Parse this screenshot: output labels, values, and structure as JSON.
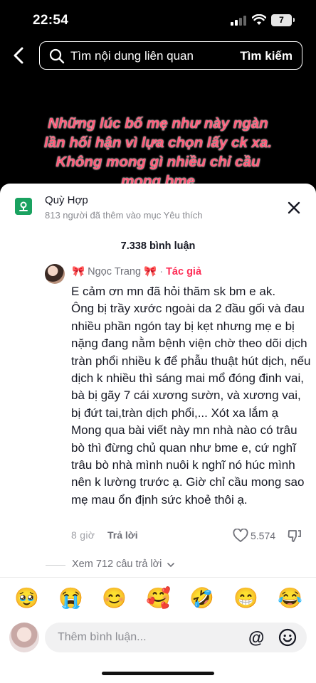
{
  "status_bar": {
    "time": "22:54",
    "battery": "7"
  },
  "search": {
    "placeholder": "Tìm nội dung liên quan",
    "action": "Tìm kiếm"
  },
  "video": {
    "caption": "Những lúc bố mẹ như này ngàn lần hối hận vì lựa chọn lấy ck xa. Không mong gì nhiều chỉ cầu mong bme"
  },
  "place": {
    "name": "Quỳ Hợp",
    "subtitle": "813 người đã thêm vào mục Yêu thích"
  },
  "comments_header": {
    "count": "7.338 bình luận"
  },
  "comment": {
    "bow_left": "🎀",
    "author": "Ngọc Trang",
    "bow_right": "🎀",
    "separator": "·",
    "badge": "Tác giả",
    "text": "E cảm ơn mn đã hỏi thăm sk bm e ak.\nÔng bị trầy xước ngoài da 2 đầu gối và đau nhiều phần ngón tay bị kẹt nhưng mẹ e bị nặng đang nằm bệnh viện chờ theo dõi dịch tràn phổi nhiều k để phẫu thuật hút dịch, nếu dịch k nhiều thì sáng mai mổ đóng đinh vai, bà bị gãy 7 cái xương sườn, và xương vai, bị đứt tai,tràn dịch phổi,... Xót xa lắm ạ\nMong qua bài viết này mn nhà nào có trâu bò thì đừng chủ quan như bme e, cứ nghĩ trâu bò nhà mình nuôi k nghĩ nó húc mình nên k lường trước ạ. Giờ chỉ cầu mong sao mẹ mau ổn định sức khoẻ thôi ạ.",
    "time": "8 giờ",
    "reply_label": "Trả lời",
    "likes": "5.574",
    "view_replies": "Xem 712 câu trả lời"
  },
  "quick_emojis": [
    "🥹",
    "😭",
    "😊",
    "🥰",
    "🤣",
    "😁",
    "😂"
  ],
  "composer": {
    "placeholder": "Thêm bình luận..."
  },
  "colors": {
    "accent": "#fe2c55",
    "place_icon": "#1aa260",
    "caption": "#ff5a78"
  }
}
